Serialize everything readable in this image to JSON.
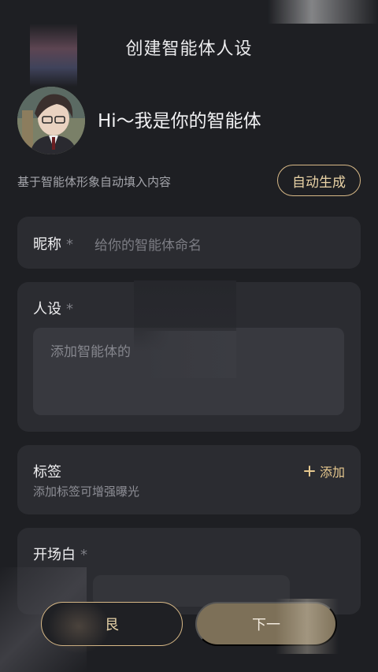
{
  "header": {
    "title": "创建智能体人设"
  },
  "profile": {
    "greeting": "Hi～我是你的智能体"
  },
  "auto_fill": {
    "hint": "基于智能体形象自动填入内容",
    "button_label": "自动生成"
  },
  "nickname": {
    "label": "昵称",
    "required_mark": "*",
    "placeholder": "给你的智能体命名"
  },
  "persona": {
    "label": "人设",
    "required_mark": "*",
    "placeholder": "添加智能体的"
  },
  "tags": {
    "label": "标签",
    "subtitle": "添加标签可增强曝光",
    "add_label": "添加",
    "add_icon": "plus-icon"
  },
  "opening": {
    "label": "开场白",
    "required_mark": "*"
  },
  "footer": {
    "prev_label": "艮",
    "next_label": "下一"
  },
  "colors": {
    "background": "#1e1f23",
    "card": "#2b2c31",
    "accent": "#d8b987",
    "next_button": "#7d7058"
  }
}
